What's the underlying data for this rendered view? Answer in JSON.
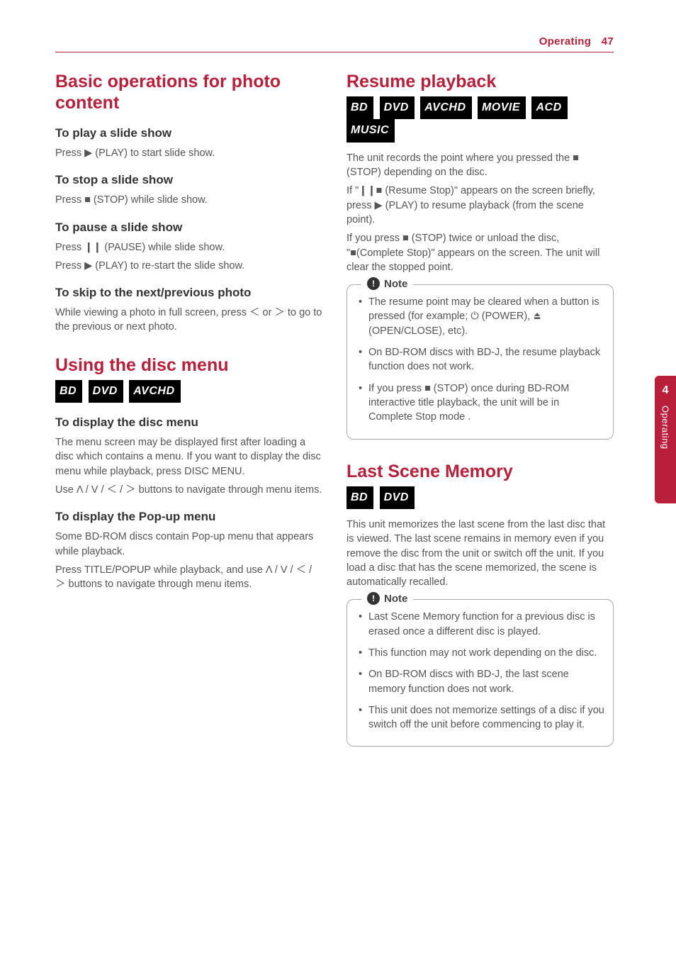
{
  "header": {
    "section": "Operating",
    "page": "47"
  },
  "sidetab": {
    "num": "4",
    "text": "Operating"
  },
  "left": {
    "h2_basic": "Basic operations for photo content",
    "play_h": "To play a slide show",
    "play_p": "Press ▶ (PLAY) to start slide show.",
    "stop_h": "To stop a slide show",
    "stop_p": "Press ■ (STOP) while slide show.",
    "pause_h": "To pause a slide show",
    "pause_p1": "Press ❙❙ (PAUSE) while slide show.",
    "pause_p2": "Press ▶ (PLAY) to re-start the slide show.",
    "skip_h": "To skip to the next/previous photo",
    "skip_p": "While viewing a photo in full screen, press ＜ or ＞ to go to the previous or next photo.",
    "h2_disc": "Using the disc menu",
    "disc_badges": [
      "BD",
      "DVD",
      "AVCHD"
    ],
    "discmenu_h": "To display the disc menu",
    "discmenu_p1": "The menu screen may be displayed first after loading a disc which contains a menu. If you want to display the disc menu while playback, press DISC MENU.",
    "discmenu_p2": "Use Λ / V / ＜ / ＞ buttons to navigate through menu items.",
    "popup_h": "To display the Pop-up menu",
    "popup_p1": "Some BD-ROM discs contain Pop-up menu that appears while playback.",
    "popup_p2": "Press TITLE/POPUP while playback, and use Λ / V / ＜ / ＞ buttons to navigate through menu items."
  },
  "right": {
    "h2_resume": "Resume playback",
    "resume_badges": [
      "BD",
      "DVD",
      "AVCHD",
      "MOVIE",
      "ACD",
      "MUSIC"
    ],
    "resume_p1": "The unit records the point where you pressed the ■ (STOP) depending on the disc.",
    "resume_p2": "If \"❙❙■ (Resume Stop)\" appears on the screen briefly, press ▶ (PLAY) to resume playback (from the scene point).",
    "resume_p3": "If you press ■ (STOP) twice or unload the disc, \"■(Complete Stop)\" appears on the screen. The unit will clear the stopped point.",
    "note_label": "Note",
    "resume_notes": [
      "The resume point may be cleared when a button is pressed (for example; ⏻ (POWER), ⏏ (OPEN/CLOSE), etc).",
      "On BD-ROM discs with BD-J, the resume playback function does not work.",
      "If you press ■ (STOP) once during BD-ROM interactive title playback, the unit will be in Complete Stop mode ."
    ],
    "h2_last": "Last Scene Memory",
    "last_badges": [
      "BD",
      "DVD"
    ],
    "last_p": "This unit memorizes the last scene from the last disc that is viewed. The last scene remains in memory even if you remove the disc from the unit or switch off the unit. If you load a disc that has the scene memorized, the scene is automatically recalled.",
    "last_notes": [
      "Last Scene Memory function for a previous disc is erased once a different disc is played.",
      "This function may not work depending on the disc.",
      "On BD-ROM discs with BD-J, the last scene memory function does not work.",
      "This unit does not memorize settings of a disc if you switch off the unit before commencing to play it."
    ]
  }
}
